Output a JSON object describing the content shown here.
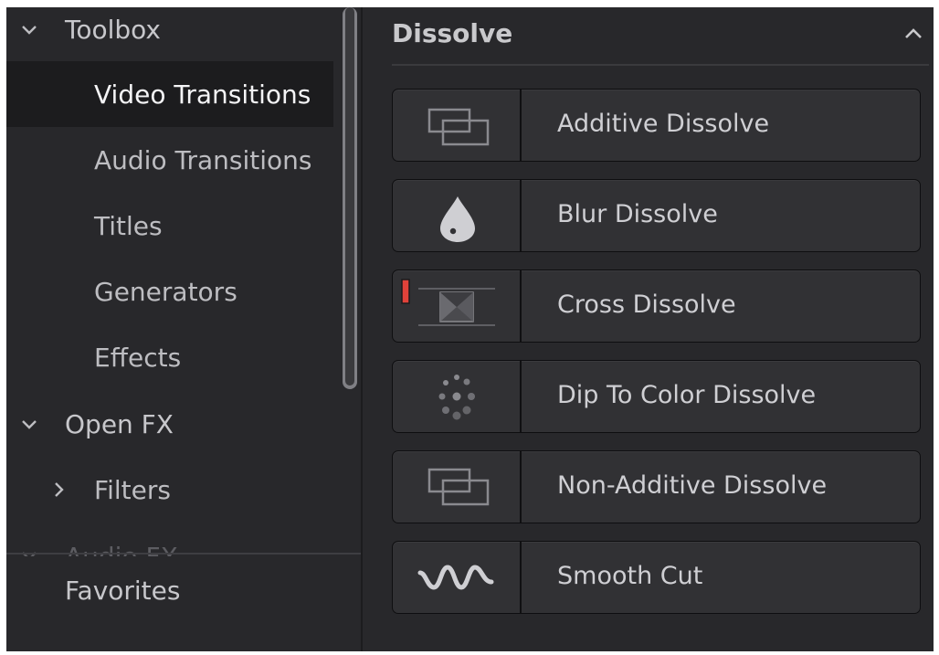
{
  "sidebar": {
    "items": [
      {
        "label": "Toolbox",
        "type": "group",
        "expanded": true
      },
      {
        "label": "Video Transitions",
        "selected": true
      },
      {
        "label": "Audio Transitions"
      },
      {
        "label": "Titles"
      },
      {
        "label": "Generators"
      },
      {
        "label": "Effects"
      },
      {
        "label": "Open FX",
        "type": "group",
        "expanded": true
      },
      {
        "label": "Filters",
        "type": "subgroup",
        "expanded": false
      }
    ],
    "partial_item": "Audio FX",
    "favorites": "Favorites"
  },
  "panel": {
    "title": "Dissolve",
    "collapse_icon": "chevron-up-icon",
    "items": [
      {
        "label": "Additive Dissolve",
        "icon": "overlap-rects-icon"
      },
      {
        "label": "Blur Dissolve",
        "icon": "drop-icon"
      },
      {
        "label": "Cross Dissolve",
        "icon": "cross-dissolve-icon",
        "favorite_marker": true
      },
      {
        "label": "Dip To Color Dissolve",
        "icon": "dots-ring-icon"
      },
      {
        "label": "Non-Additive Dissolve",
        "icon": "overlap-rects-icon"
      },
      {
        "label": "Smooth Cut",
        "icon": "wave-icon"
      }
    ]
  },
  "colors": {
    "background": "#28282b",
    "selected_row": "#1c1c1e",
    "marker_red": "#e0423a"
  }
}
